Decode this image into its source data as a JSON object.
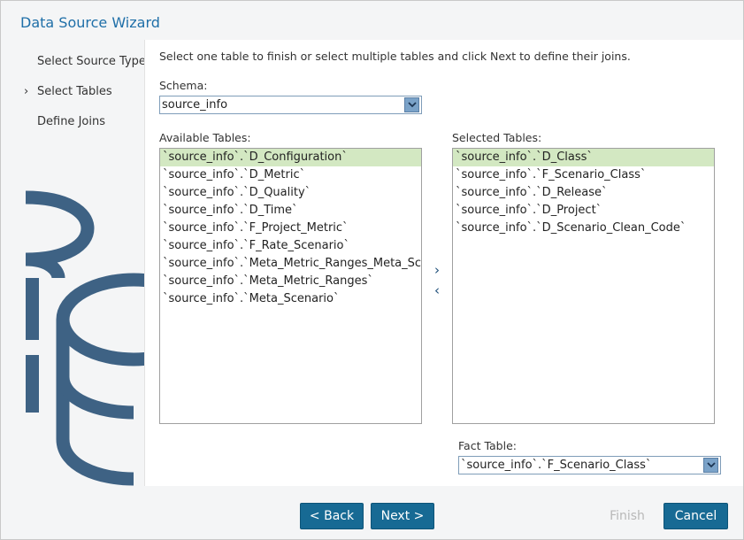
{
  "dialog": {
    "title": "Data Source Wizard"
  },
  "steps": [
    {
      "label": "Select Source Type",
      "current": false
    },
    {
      "label": "Select Tables",
      "current": true
    },
    {
      "label": "Define Joins",
      "current": false
    }
  ],
  "content": {
    "instruction": "Select one table to finish or select multiple tables and click Next to define their joins.",
    "schema": {
      "label": "Schema:",
      "value": "source_info"
    },
    "available": {
      "label": "Available Tables:",
      "selected_index": 0,
      "items": [
        "`source_info`.`D_Configuration`",
        "`source_info`.`D_Metric`",
        "`source_info`.`D_Quality`",
        "`source_info`.`D_Time`",
        "`source_info`.`F_Project_Metric`",
        "`source_info`.`F_Rate_Scenario`",
        "`source_info`.`Meta_Metric_Ranges_Meta_Sc",
        "`source_info`.`Meta_Metric_Ranges`",
        "`source_info`.`Meta_Scenario`"
      ]
    },
    "selected": {
      "label": "Selected Tables:",
      "selected_index": 0,
      "items": [
        "`source_info`.`D_Class`",
        "`source_info`.`F_Scenario_Class`",
        "`source_info`.`D_Release`",
        "`source_info`.`D_Project`",
        "`source_info`.`D_Scenario_Clean_Code`"
      ]
    },
    "movers": {
      "add": "›",
      "remove": "‹"
    },
    "fact_table": {
      "label": "Fact Table:",
      "value": "`source_info`.`F_Scenario_Class`"
    }
  },
  "buttons": {
    "back": "< Back",
    "next": "Next >",
    "finish": "Finish",
    "cancel": "Cancel"
  },
  "colors": {
    "accent": "#176a94",
    "title": "#1f6fa8",
    "selection": "#d3e8c2",
    "decoration": "#3e6284"
  },
  "icons": {
    "step_indicator": "chevron-right-icon",
    "dropdown": "chevron-down-icon",
    "decoration": "database-icon"
  }
}
